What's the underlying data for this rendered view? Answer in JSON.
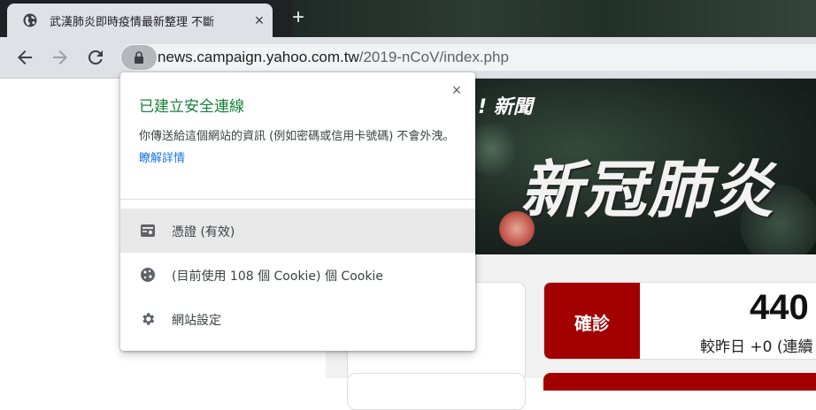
{
  "tab": {
    "title": "武漢肺炎即時疫情最新整理 不斷",
    "close_icon": "×",
    "new_tab_icon": "+"
  },
  "toolbar": {
    "url_host": "news.campaign.yahoo.com.tw",
    "url_path": "/2019-nCoV/index.php"
  },
  "popup": {
    "close_icon": "×",
    "title": "已建立安全連線",
    "description": "你傳送給這個網站的資訊 (例如密碼或信用卡號碼) 不會外洩。",
    "learn_more": "瞭解詳情",
    "rows": [
      {
        "label": "憑證 (有效)",
        "icon": "certificate-icon"
      },
      {
        "label": "(目前使用 108 個 Cookie) 個 Cookie",
        "icon": "cookie-icon"
      },
      {
        "label": "網站設定",
        "icon": "gear-icon"
      }
    ]
  },
  "page": {
    "hero_brand": "! 新聞",
    "hero_title": "新冠肺炎",
    "stat": {
      "label": "確診",
      "value": "440",
      "delta": "較昨日 +0 (連續"
    }
  },
  "colors": {
    "secure_green": "#188038",
    "link_blue": "#1a73e8",
    "stat_red": "#a30000"
  }
}
